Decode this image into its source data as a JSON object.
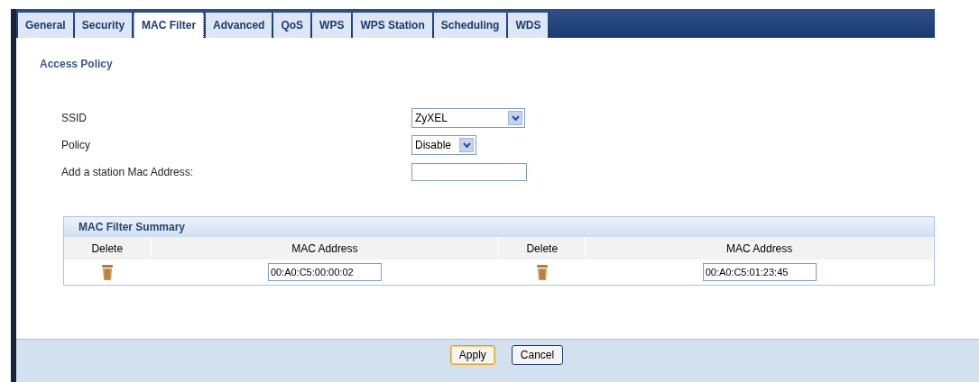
{
  "tabs": [
    {
      "label": "General",
      "selected": false
    },
    {
      "label": "Security",
      "selected": false
    },
    {
      "label": "MAC Filter",
      "selected": true
    },
    {
      "label": "Advanced",
      "selected": false
    },
    {
      "label": "QoS",
      "selected": false
    },
    {
      "label": "WPS",
      "selected": false
    },
    {
      "label": "WPS Station",
      "selected": false
    },
    {
      "label": "Scheduling",
      "selected": false
    },
    {
      "label": "WDS",
      "selected": false
    }
  ],
  "section_title": "Access Policy",
  "fields": [
    {
      "kind": "select",
      "label": "SSID",
      "value": "ZyXEL"
    },
    {
      "kind": "select_small",
      "label": "Policy",
      "value": "Disable"
    },
    {
      "kind": "input",
      "label": "Add a station Mac Address:"
    }
  ],
  "summary": {
    "title": "MAC Filter Summary",
    "columns": [
      "Delete",
      "MAC Address",
      "Delete",
      "MAC Address"
    ],
    "rows": [
      {
        "entries": [
          "00:A0:C5:00:00:02",
          "00:A0:C5:01:23:45"
        ]
      }
    ]
  },
  "buttons": [
    {
      "label": "Apply",
      "kind": "primary"
    },
    {
      "label": "Cancel",
      "kind": "secondary"
    }
  ]
}
